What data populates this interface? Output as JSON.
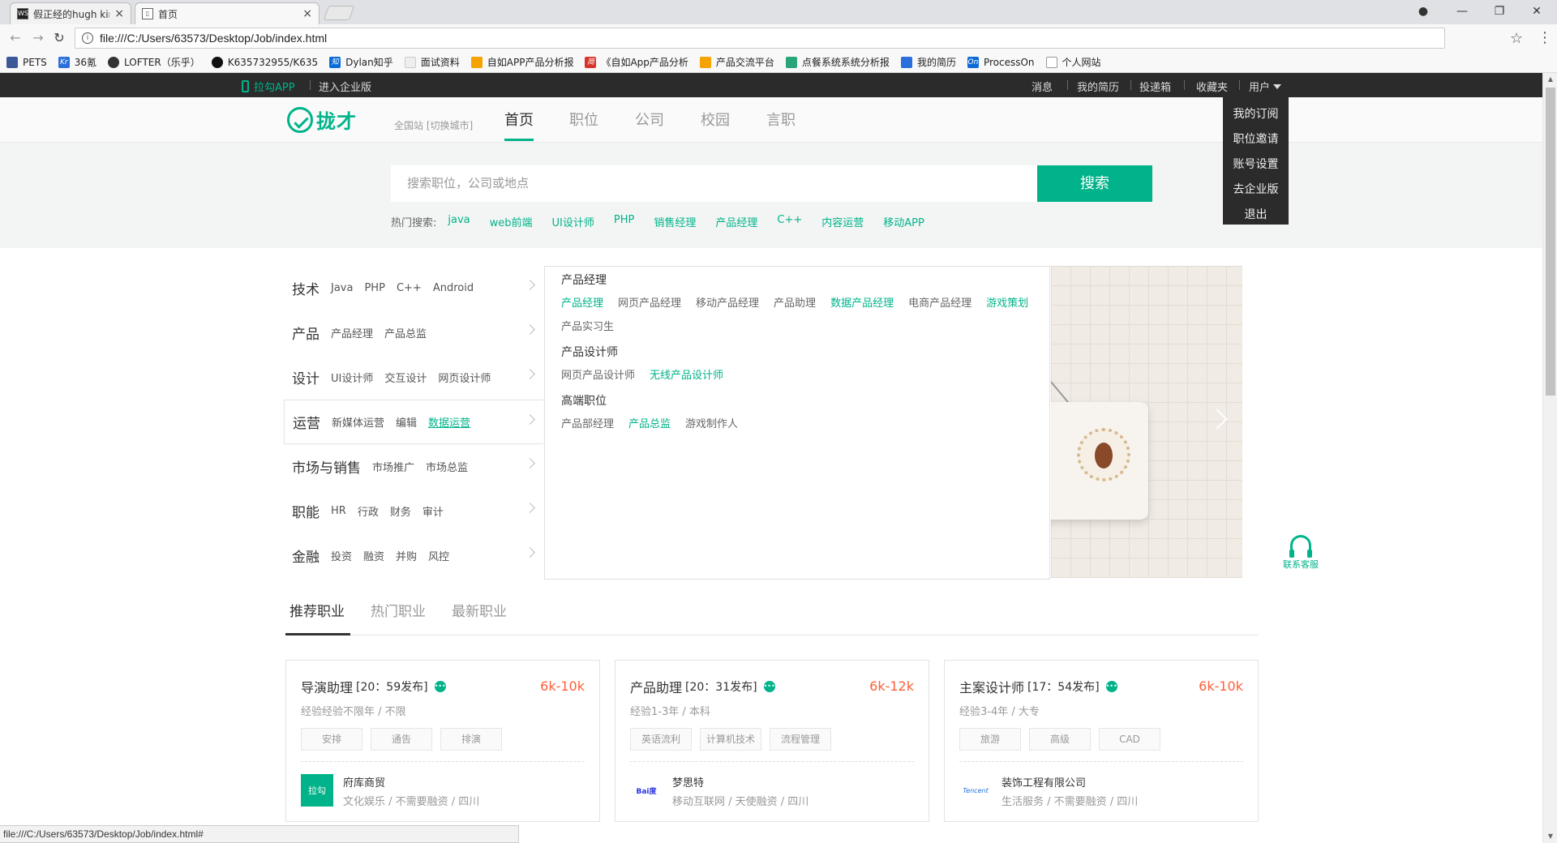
{
  "browser": {
    "tabs": [
      {
        "title": "假正经的hugh kim的个人",
        "active": false
      },
      {
        "title": "首页",
        "active": true
      }
    ],
    "url": "file:///C:/Users/63573/Desktop/Job/index.html",
    "bookmarks": [
      "PETS",
      "36氪",
      "LOFTER（乐乎）",
      "K635732955/K635",
      "Dylan知乎",
      "面试资料",
      "自如APP产品分析报",
      "《自如App产品分析",
      "产品交流平台",
      "点餐系统系统分析报",
      "我的简历",
      "ProcessOn",
      "个人网站"
    ],
    "status_url": "file:///C:/Users/63573/Desktop/Job/index.html#"
  },
  "topbar": {
    "app_link": "拉勾APP",
    "corp_link": "进入企业版",
    "right_items": [
      "消息",
      "我的简历",
      "投递箱",
      "收藏夹"
    ],
    "user_menu": "用户",
    "user_dropdown": [
      "我的订阅",
      "职位邀请",
      "账号设置",
      "去企业版",
      "退出"
    ]
  },
  "header": {
    "logo_text": "拢才",
    "city": "全国站 [切换城市]",
    "nav": [
      "首页",
      "职位",
      "公司",
      "校园",
      "言职"
    ],
    "active_nav": "首页"
  },
  "search": {
    "placeholder": "搜索职位，公司或地点",
    "button": "搜索",
    "hot_label": "热门搜索:",
    "hot_keywords": [
      "java",
      "web前端",
      "UI设计师",
      "PHP",
      "销售经理",
      "产品经理",
      "C++",
      "内容运营",
      "移动APP"
    ]
  },
  "categories": [
    {
      "name": "技术",
      "subs": [
        "Java",
        "PHP",
        "C++",
        "Android"
      ]
    },
    {
      "name": "产品",
      "subs": [
        "产品经理",
        "产品总监"
      ]
    },
    {
      "name": "设计",
      "subs": [
        "UI设计师",
        "交互设计",
        "网页设计师"
      ]
    },
    {
      "name": "运营",
      "subs": [
        "新媒体运营",
        "编辑",
        "数据运营"
      ]
    },
    {
      "name": "市场与销售",
      "subs": [
        "市场推广",
        "市场总监"
      ]
    },
    {
      "name": "职能",
      "subs": [
        "HR",
        "行政",
        "财务",
        "审计"
      ]
    },
    {
      "name": "金融",
      "subs": [
        "投资",
        "融资",
        "并购",
        "风控"
      ]
    }
  ],
  "category_panel": [
    {
      "title": "产品经理",
      "links": [
        "产品经理",
        "网页产品经理",
        "移动产品经理",
        "产品助理",
        "数据产品经理",
        "电商产品经理",
        "游戏策划",
        "产品实习生"
      ],
      "highlight": [
        "产品经理",
        "数据产品经理",
        "游戏策划"
      ]
    },
    {
      "title": "产品设计师",
      "links": [
        "网页产品设计师",
        "无线产品设计师"
      ],
      "highlight": [
        "无线产品设计师"
      ]
    },
    {
      "title": "高端职位",
      "links": [
        "产品部经理",
        "产品总监",
        "游戏制作人"
      ],
      "highlight": [
        "产品总监"
      ]
    }
  ],
  "service": "联系客服",
  "job_tabs": [
    "推荐职业",
    "热门职业",
    "最新职业"
  ],
  "jobs": [
    {
      "title": "导演助理",
      "time": "[20：59发布]",
      "salary": "6k-10k",
      "req": "经验经验不限年 / 不限",
      "tags": [
        "安排",
        "通告",
        "排演"
      ],
      "company": "府库商贸",
      "company_info": "文化娱乐 / 不需要融资 / 四川",
      "logo_text": "拉勾",
      "logo_color": "#00b38a"
    },
    {
      "title": "产品助理",
      "time": "[20：31发布]",
      "salary": "6k-12k",
      "req": "经验1-3年 / 本科",
      "tags": [
        "英语流利",
        "计算机技术",
        "流程管理"
      ],
      "company": "梦思特",
      "company_info": "移动互联网 / 天使融资 / 四川",
      "logo_text": "Bai度",
      "logo_color": "#2932e1"
    },
    {
      "title": "主案设计师",
      "time": "[17：54发布]",
      "salary": "6k-10k",
      "req": "经验3-4年 / 大专",
      "tags": [
        "旅游",
        "高级",
        "CAD"
      ],
      "company": "装饰工程有限公司",
      "company_info": "生活服务 / 不需要融资 / 四川",
      "logo_text": "Tencent",
      "logo_color": "#1e6fd8"
    }
  ]
}
